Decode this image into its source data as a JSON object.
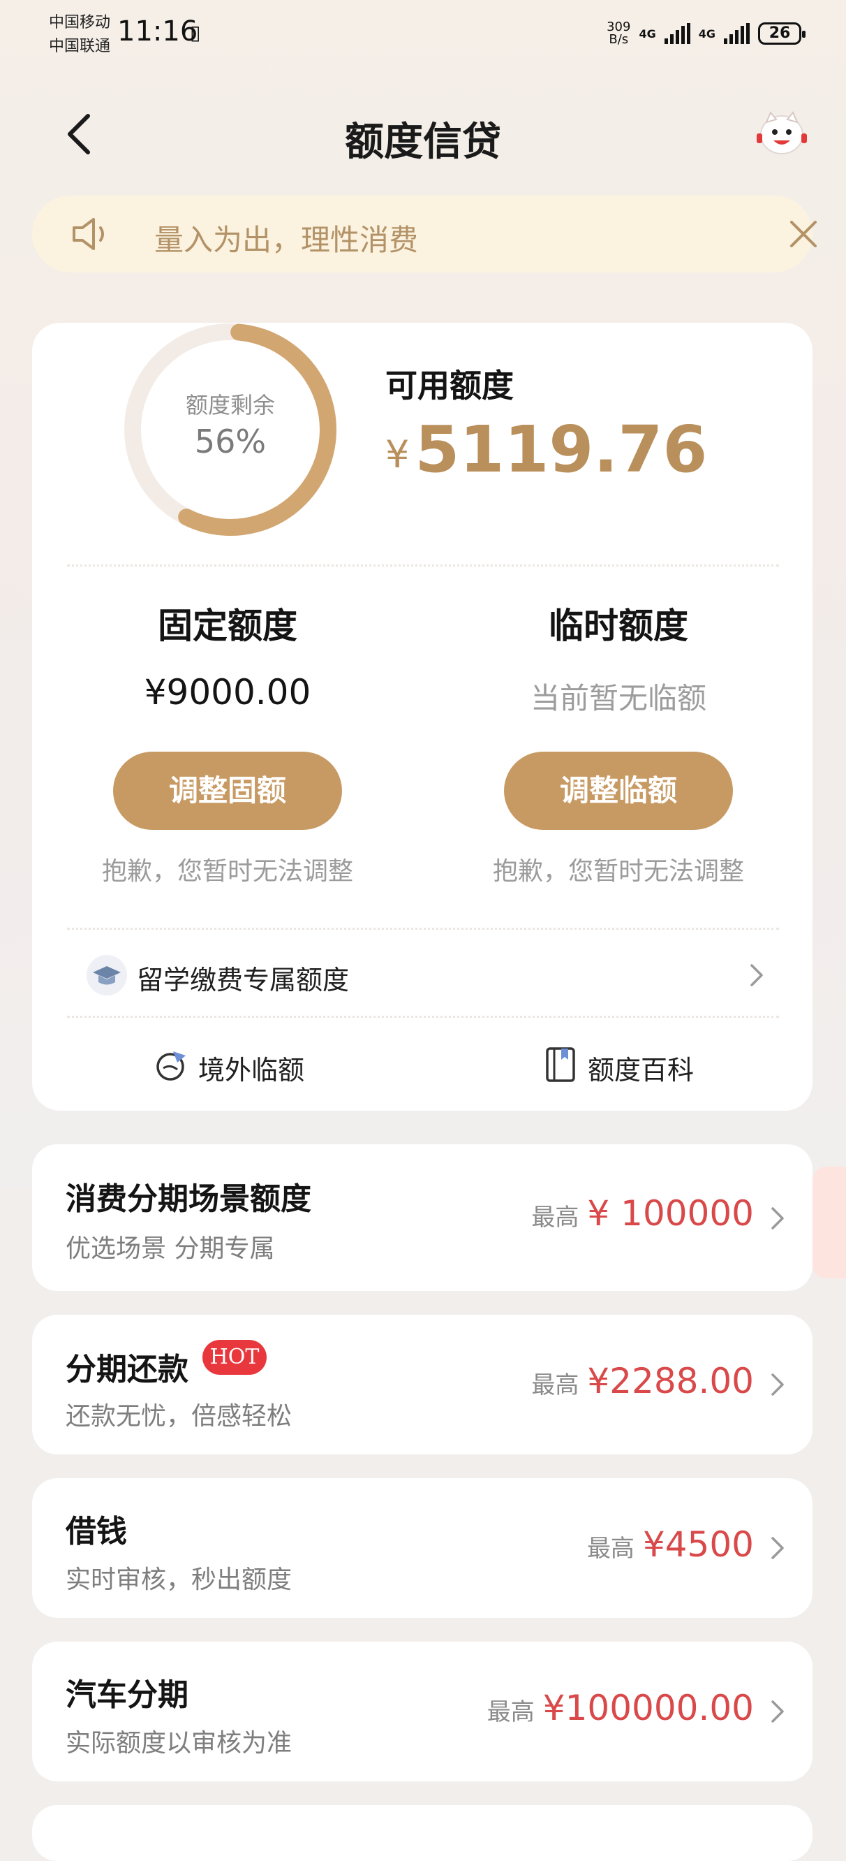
{
  "status_bar": {
    "carrier1": "中国移动",
    "carrier2": "中国联通",
    "time": "11:16",
    "speed_value": "309",
    "speed_unit": "B/s",
    "net1": "4G",
    "net2": "4G",
    "battery": "26"
  },
  "nav": {
    "title": "额度信贷"
  },
  "notice": {
    "text": "量入为出，理性消费"
  },
  "credit": {
    "ring_label": "额度剩余",
    "ring_percent": "56%",
    "ring_fraction": 0.56,
    "available_label": "可用额度",
    "currency_symbol": "¥",
    "available_amount": "5119.76",
    "fixed": {
      "title": "固定额度",
      "value": "¥9000.00",
      "button": "调整固额",
      "note": "抱歉，您暂时无法调整"
    },
    "temporary": {
      "title": "临时额度",
      "value": "当前暂无临额",
      "button": "调整临额",
      "note": "抱歉，您暂时无法调整"
    },
    "study_abroad": "留学缴费专属额度",
    "links": {
      "overseas": "境外临额",
      "wiki": "额度百科"
    }
  },
  "products": [
    {
      "title": "消费分期场景额度",
      "subtitle": "优选场景 分期专属",
      "prefix": "最高",
      "amount": "¥ 100000"
    },
    {
      "title": "分期还款",
      "badge": "HOT",
      "subtitle": "还款无忧，倍感轻松",
      "prefix": "最高",
      "amount": "¥2288.00"
    },
    {
      "title": "借钱",
      "subtitle": "实时审核，秒出额度",
      "prefix": "最高",
      "amount": "¥4500"
    },
    {
      "title": "汽车分期",
      "subtitle": "实际额度以审核为准",
      "prefix": "最高",
      "amount": "¥100000.00"
    }
  ],
  "colors": {
    "accent": "#c89a63",
    "amount_gold": "#b98f5b",
    "red": "#d9494a",
    "notice_bg": "#fbf3e0"
  },
  "icons": {
    "back": "back-arrow-icon",
    "mascot": "mascot-icon",
    "speaker": "speaker-icon",
    "close": "close-icon",
    "study": "graduation-cap-icon",
    "overseas": "plane-globe-icon",
    "wiki": "book-icon",
    "chevron": "chevron-right-icon"
  }
}
